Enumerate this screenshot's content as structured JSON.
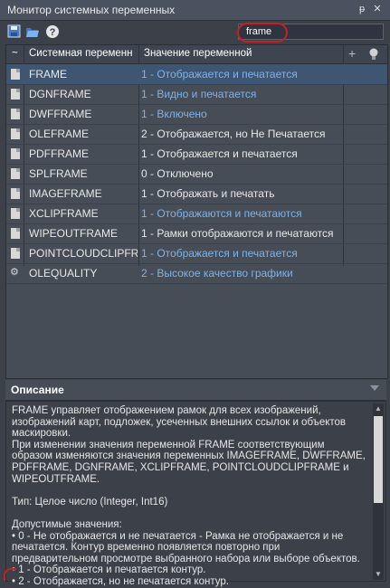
{
  "window": {
    "title": "Монитор системных переменных",
    "pin_label": "₽",
    "close_label": "✕"
  },
  "toolbar": {
    "search_value": "frame"
  },
  "grid": {
    "headers": {
      "col0": "~",
      "col1": "Системная переменн",
      "col2": "Значение переменной",
      "add": "+"
    },
    "rows": [
      {
        "name": "FRAME",
        "value": "1 - Отображается и печатается",
        "selected": true,
        "value_color": "blue",
        "icon": "doc"
      },
      {
        "name": "DGNFRAME",
        "value": "1 - Видно и печатается",
        "value_color": "blue",
        "icon": "doc"
      },
      {
        "name": "DWFFRAME",
        "value": "1 - Включено",
        "value_color": "blue",
        "icon": "doc"
      },
      {
        "name": "OLEFRAME",
        "value": "2 - Отображается, но Не Печатается",
        "value_color": "white",
        "icon": "doc"
      },
      {
        "name": "PDFFRAME",
        "value": "1 - Отображается и печатается",
        "value_color": "white",
        "icon": "doc"
      },
      {
        "name": "SPLFRAME",
        "value": "0 - Отключено",
        "value_color": "white",
        "icon": "doc"
      },
      {
        "name": "IMAGEFRAME",
        "value": "1 - Отображать и печатать",
        "value_color": "white",
        "icon": "doc"
      },
      {
        "name": "XCLIPFRAME",
        "value": "1 - Отображаются и печатаются",
        "value_color": "blue",
        "icon": "doc"
      },
      {
        "name": "WIPEOUTFRAME",
        "value": "1 - Рамки отображаются и печатаются",
        "value_color": "white",
        "icon": "doc"
      },
      {
        "name": "POINTCLOUDCLIPFRAME",
        "value": "1 - Отображается и печатается",
        "value_color": "blue",
        "icon": "doc"
      },
      {
        "name": "OLEQUALITY",
        "value": "2 - Высокое качество графики",
        "value_color": "blue",
        "icon": "gear"
      }
    ]
  },
  "description": {
    "heading": "Описание",
    "text": "FRAME управляет отображением рамок для всех изображений, изображений карт, подложек, усеченных внешних ссылок и объектов маскировки.\nПри изменении значения переменной FRAME соответствующим образом изменяются значения переменных IMAGEFRAME, DWFFRAME, PDFFRAME, DGNFRAME, XCLIPFRAME, POINTCLOUDCLIPFRAME и WIPEOUTFRAME.\n\nТип: Целое число (Integer, Int16)\n\nДопустимые значения:\n• 0 - Не отображается и не печатается - Рамка не отображается и не печатается. Контур временно появляется повторно при предварительном просмотре выбранного набора или выборе объектов.\n• 1 - Отображается и печатается контур.\n• 2 - Отображается, но не печатается контур."
  }
}
